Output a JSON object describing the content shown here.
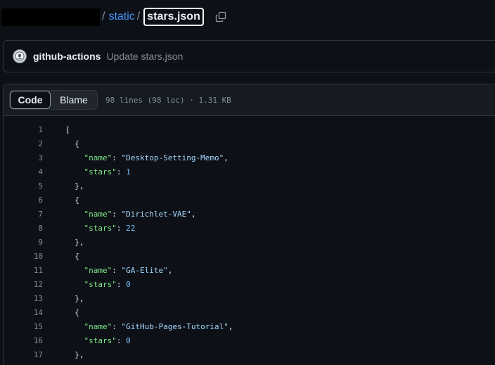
{
  "breadcrumb": {
    "separator": "/",
    "folder": "static",
    "file": "stars.json"
  },
  "commit": {
    "author": "github-actions",
    "message": "Update stars.json"
  },
  "file_header": {
    "code_tab": "Code",
    "blame_tab": "Blame",
    "info": "98 lines (98 loc) · 1.31 KB"
  },
  "code_lines": [
    {
      "n": "1",
      "tokens": [
        {
          "t": "[",
          "c": "p"
        }
      ]
    },
    {
      "n": "2",
      "tokens": [
        {
          "t": "  {",
          "c": "p"
        }
      ]
    },
    {
      "n": "3",
      "tokens": [
        {
          "t": "    ",
          "c": "p"
        },
        {
          "t": "\"name\"",
          "c": "key"
        },
        {
          "t": ": ",
          "c": "p"
        },
        {
          "t": "\"Desktop-Setting-Memo\"",
          "c": "str"
        },
        {
          "t": ",",
          "c": "p"
        }
      ]
    },
    {
      "n": "4",
      "tokens": [
        {
          "t": "    ",
          "c": "p"
        },
        {
          "t": "\"stars\"",
          "c": "key"
        },
        {
          "t": ": ",
          "c": "p"
        },
        {
          "t": "1",
          "c": "num"
        }
      ]
    },
    {
      "n": "5",
      "tokens": [
        {
          "t": "  },",
          "c": "p"
        }
      ]
    },
    {
      "n": "6",
      "tokens": [
        {
          "t": "  {",
          "c": "p"
        }
      ]
    },
    {
      "n": "7",
      "tokens": [
        {
          "t": "    ",
          "c": "p"
        },
        {
          "t": "\"name\"",
          "c": "key"
        },
        {
          "t": ": ",
          "c": "p"
        },
        {
          "t": "\"Dirichlet-VAE\"",
          "c": "str"
        },
        {
          "t": ",",
          "c": "p"
        }
      ]
    },
    {
      "n": "8",
      "tokens": [
        {
          "t": "    ",
          "c": "p"
        },
        {
          "t": "\"stars\"",
          "c": "key"
        },
        {
          "t": ": ",
          "c": "p"
        },
        {
          "t": "22",
          "c": "num"
        }
      ]
    },
    {
      "n": "9",
      "tokens": [
        {
          "t": "  },",
          "c": "p"
        }
      ]
    },
    {
      "n": "10",
      "tokens": [
        {
          "t": "  {",
          "c": "p"
        }
      ]
    },
    {
      "n": "11",
      "tokens": [
        {
          "t": "    ",
          "c": "p"
        },
        {
          "t": "\"name\"",
          "c": "key"
        },
        {
          "t": ": ",
          "c": "p"
        },
        {
          "t": "\"GA-Elite\"",
          "c": "str"
        },
        {
          "t": ",",
          "c": "p"
        }
      ]
    },
    {
      "n": "12",
      "tokens": [
        {
          "t": "    ",
          "c": "p"
        },
        {
          "t": "\"stars\"",
          "c": "key"
        },
        {
          "t": ": ",
          "c": "p"
        },
        {
          "t": "0",
          "c": "num"
        }
      ]
    },
    {
      "n": "13",
      "tokens": [
        {
          "t": "  },",
          "c": "p"
        }
      ]
    },
    {
      "n": "14",
      "tokens": [
        {
          "t": "  {",
          "c": "p"
        }
      ]
    },
    {
      "n": "15",
      "tokens": [
        {
          "t": "    ",
          "c": "p"
        },
        {
          "t": "\"name\"",
          "c": "key"
        },
        {
          "t": ": ",
          "c": "p"
        },
        {
          "t": "\"GitHub-Pages-Tutorial\"",
          "c": "str"
        },
        {
          "t": ",",
          "c": "p"
        }
      ]
    },
    {
      "n": "16",
      "tokens": [
        {
          "t": "    ",
          "c": "p"
        },
        {
          "t": "\"stars\"",
          "c": "key"
        },
        {
          "t": ": ",
          "c": "p"
        },
        {
          "t": "0",
          "c": "num"
        }
      ]
    },
    {
      "n": "17",
      "tokens": [
        {
          "t": "  },",
          "c": "p"
        }
      ]
    }
  ],
  "colors": {
    "background": "#0d1117",
    "link": "#4493f8",
    "json_key": "#7ee787",
    "json_string": "#a5d6ff",
    "json_number": "#79c0ff"
  },
  "icons": {
    "copy": "copy-icon",
    "avatar": "github-actions-avatar"
  }
}
